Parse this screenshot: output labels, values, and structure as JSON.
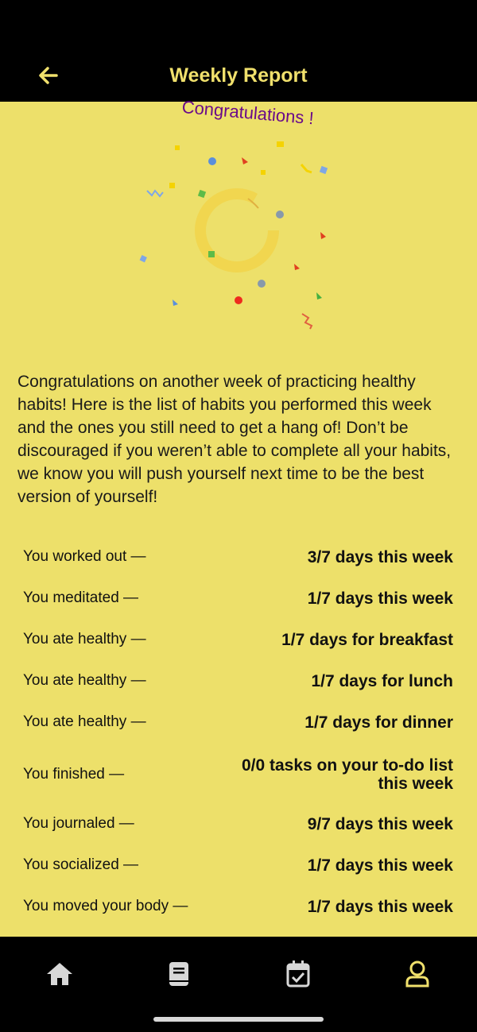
{
  "header": {
    "title": "Weekly Report",
    "back_icon": "arrow-left-icon"
  },
  "celebration": {
    "title": "Congratulations !"
  },
  "intro": "Congratulations on another week of practicing healthy habits! Here is the list of habits you performed this week and the ones you still need to get a hang of! Don’t be discouraged if you weren’t able to complete all your habits, we know you will push yourself next time to be the best version of yourself!",
  "habits": [
    {
      "label": "You worked out —",
      "value": "3/7 days this week"
    },
    {
      "label": "You meditated —",
      "value": "1/7 days this week"
    },
    {
      "label": "You ate healthy —",
      "value": "1/7 days for breakfast"
    },
    {
      "label": "You ate healthy —",
      "value": "1/7 days for lunch"
    },
    {
      "label": "You ate healthy —",
      "value": "1/7 days for dinner"
    },
    {
      "label": "You finished —",
      "value": "0/0 tasks on your to-do list this week"
    },
    {
      "label": "You journaled —",
      "value": "9/7 days this week"
    },
    {
      "label": "You socialized —",
      "value": "1/7 days this week"
    },
    {
      "label": "You moved your body —",
      "value": "1/7 days this week"
    }
  ],
  "nav": {
    "items": [
      {
        "icon": "home-icon"
      },
      {
        "icon": "book-icon"
      },
      {
        "icon": "calendar-check-icon"
      },
      {
        "icon": "user-icon",
        "active": true
      }
    ]
  },
  "colors": {
    "background": "#ede06a",
    "bar": "#000000",
    "accent": "#f0e06c",
    "nav_inactive": "#d8d8d8",
    "congrats_text": "#6a0a8a"
  }
}
